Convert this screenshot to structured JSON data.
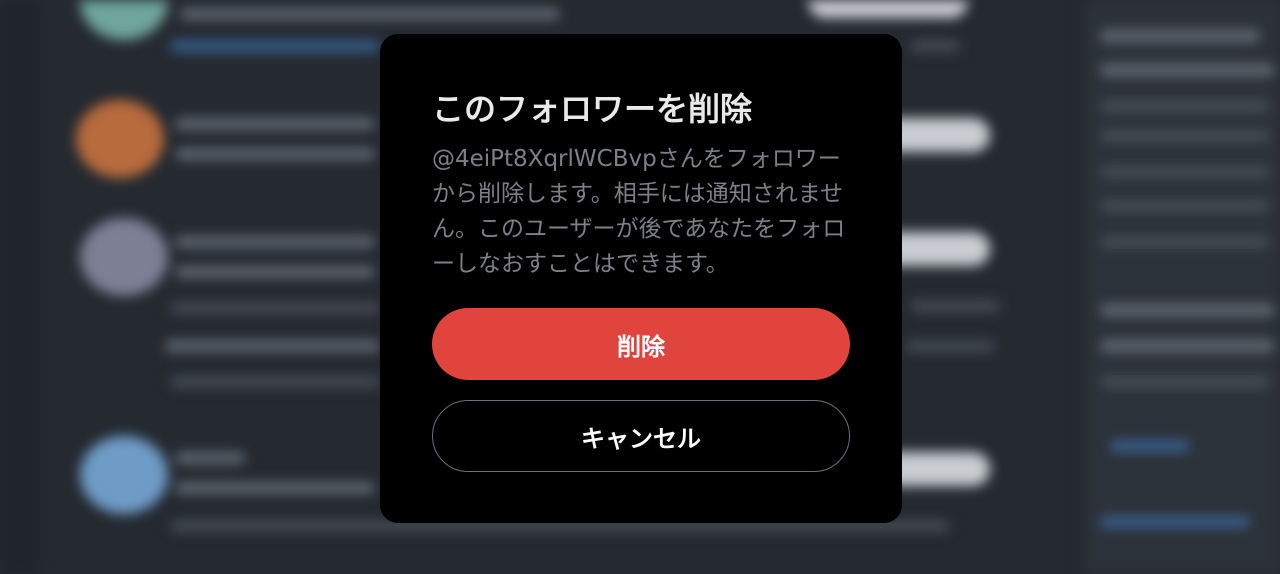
{
  "dialog": {
    "title": "このフォロワーを削除",
    "description": "@4eiPt8XqrlWCBvpさんをフォロワーから削除します。相手には通知されません。このユーザーが後であなたをフォローしなおすことはできます。",
    "delete_label": "削除",
    "cancel_label": "キャンセル"
  },
  "colors": {
    "modal_background": "#000000",
    "delete_button": "#e0443c",
    "backdrop": "#252a31"
  }
}
